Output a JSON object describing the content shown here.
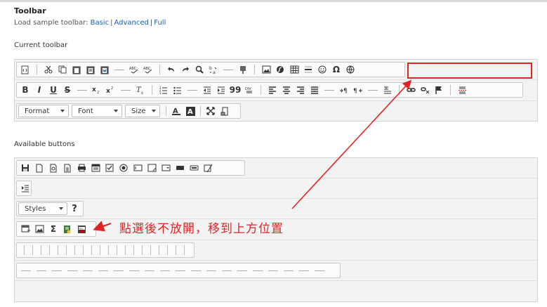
{
  "page": {
    "title": "Toolbar",
    "load_label": "Load sample toolbar:",
    "links": [
      "Basic",
      "Advanced",
      "Full"
    ],
    "link_sep": "|",
    "current_label": "Current toolbar",
    "available_label": "Available buttons"
  },
  "current_toolbar": {
    "combos": [
      "Format",
      "Font",
      "Size"
    ]
  },
  "available": {
    "styles_combo": "Styles",
    "help_label": "?"
  },
  "annotation": {
    "text": "點選後不放開，移到上方位置"
  },
  "colors": {
    "accent_red": "#e02424",
    "link_blue": "#1a5ea8"
  }
}
